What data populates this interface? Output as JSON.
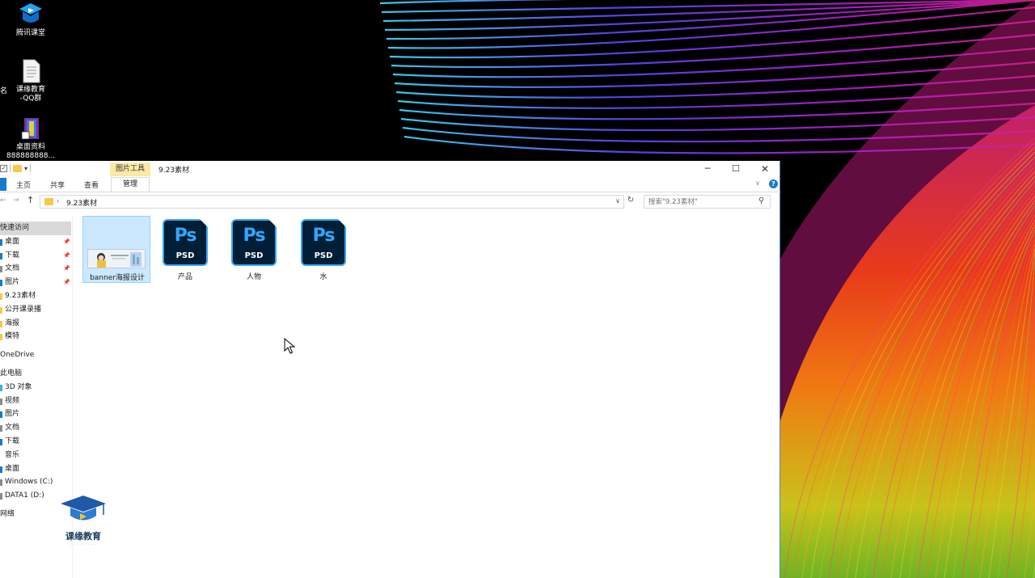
{
  "desktop": {
    "icons": [
      {
        "label_line1": "腾讯课堂",
        "label_line2": "",
        "icon": "tencent-classroom-icon"
      },
      {
        "label_line1": "课缘教育",
        "label_line2": "-QQ群",
        "icon": "text-document-icon"
      },
      {
        "label_line1": "桌面资料",
        "label_line2": "888888888...",
        "icon": "winrar-archive-icon"
      }
    ],
    "edge_text": "名"
  },
  "window": {
    "qat_check": "✓",
    "context_tab_header": "图片工具",
    "title": "9.23素材",
    "controls": {
      "minimize": "─",
      "maximize": "☐",
      "close": "✕"
    }
  },
  "ribbon": {
    "tabs": [
      "主页",
      "共享",
      "查看"
    ],
    "active_context_tab": "管理",
    "help": "?"
  },
  "address": {
    "back": "←",
    "forward": "→",
    "up": "↑",
    "separator": "›",
    "path": "9.23素材",
    "dropdown": "∨",
    "refresh": "↻",
    "search_placeholder": "搜索\"9.23素材\""
  },
  "navigation": {
    "items": [
      {
        "label": "快速访问",
        "section": true,
        "selected": true,
        "pinned": false,
        "mark": ""
      },
      {
        "label": "桌面",
        "section": false,
        "selected": false,
        "pinned": true,
        "mark": "#1979ca"
      },
      {
        "label": "下载",
        "section": false,
        "selected": false,
        "pinned": true,
        "mark": "#1979ca"
      },
      {
        "label": "文档",
        "section": false,
        "selected": false,
        "pinned": true,
        "mark": "#8a8a8a"
      },
      {
        "label": "图片",
        "section": false,
        "selected": false,
        "pinned": true,
        "mark": "#1979ca"
      },
      {
        "label": "9.23素材",
        "section": false,
        "selected": false,
        "pinned": false,
        "mark": "#f6c94c"
      },
      {
        "label": "公开课录播",
        "section": false,
        "selected": false,
        "pinned": false,
        "mark": "#f6c94c"
      },
      {
        "label": "海报",
        "section": false,
        "selected": false,
        "pinned": false,
        "mark": "#f6c94c"
      },
      {
        "label": "模特",
        "section": false,
        "selected": false,
        "pinned": false,
        "mark": "#f6c94c"
      },
      {
        "label": "OneDrive",
        "section": true,
        "selected": false,
        "pinned": false,
        "mark": ""
      },
      {
        "label": "此电脑",
        "section": true,
        "selected": false,
        "pinned": false,
        "mark": ""
      },
      {
        "label": "3D 对象",
        "section": false,
        "selected": false,
        "pinned": false,
        "mark": "#3ab0e0"
      },
      {
        "label": "视频",
        "section": false,
        "selected": false,
        "pinned": false,
        "mark": "#8a8a8a"
      },
      {
        "label": "图片",
        "section": false,
        "selected": false,
        "pinned": false,
        "mark": "#1979ca"
      },
      {
        "label": "文档",
        "section": false,
        "selected": false,
        "pinned": false,
        "mark": "#8a8a8a"
      },
      {
        "label": "下载",
        "section": false,
        "selected": false,
        "pinned": false,
        "mark": "#1979ca"
      },
      {
        "label": "音乐",
        "section": false,
        "selected": false,
        "pinned": false,
        "mark": ""
      },
      {
        "label": "桌面",
        "section": false,
        "selected": false,
        "pinned": false,
        "mark": "#1979ca"
      },
      {
        "label": "Windows (C:)",
        "section": false,
        "selected": false,
        "pinned": false,
        "mark": "#8a8a8a"
      },
      {
        "label": "DATA1 (D:)",
        "section": false,
        "selected": false,
        "pinned": false,
        "mark": "#8a8a8a"
      },
      {
        "label": "网络",
        "section": true,
        "selected": false,
        "pinned": false,
        "mark": ""
      }
    ],
    "pin_glyph": "📌"
  },
  "files": [
    {
      "name": "banner海报设计",
      "type": "image",
      "selected": true
    },
    {
      "name": "产品",
      "type": "psd",
      "selected": false,
      "ps": "Ps",
      "ext": "PSD"
    },
    {
      "name": "人物",
      "type": "psd",
      "selected": false,
      "ps": "Ps",
      "ext": "PSD"
    },
    {
      "name": "水",
      "type": "psd",
      "selected": false,
      "ps": "Ps",
      "ext": "PSD"
    }
  ],
  "watermark": {
    "name": "课缘教育"
  },
  "colors": {
    "accent": "#1979ca",
    "selection": "#cce8ff",
    "psd_bg": "#001e36",
    "psd_blue": "#31a8ff",
    "context_tab": "#fbe9a4"
  }
}
